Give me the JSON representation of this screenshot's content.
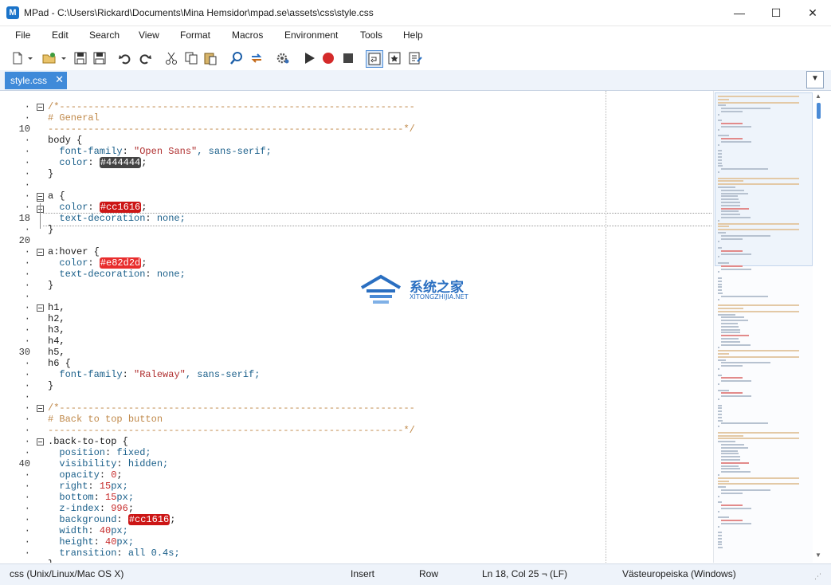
{
  "window": {
    "app_icon_letter": "M",
    "title": "MPad - C:\\Users\\Rickard\\Documents\\Mina Hemsidor\\mpad.se\\assets\\css\\style.css",
    "minimize": "—",
    "maximize": "☐",
    "close": "✕"
  },
  "menu": [
    "File",
    "Edit",
    "Search",
    "View",
    "Format",
    "Macros",
    "Environment",
    "Tools",
    "Help"
  ],
  "tab": {
    "label": "style.css",
    "close": "✕",
    "dropdown": "▼"
  },
  "gutter": {
    "numbers": [
      {
        "row": 0,
        "text": "·"
      },
      {
        "row": 1,
        "text": "·"
      },
      {
        "row": 2,
        "text": "10"
      },
      {
        "row": 3,
        "text": "·"
      },
      {
        "row": 4,
        "text": "·"
      },
      {
        "row": 5,
        "text": "·"
      },
      {
        "row": 6,
        "text": "·"
      },
      {
        "row": 7,
        "text": "·"
      },
      {
        "row": 8,
        "text": "·"
      },
      {
        "row": 9,
        "text": "·"
      },
      {
        "row": 10,
        "text": "18"
      },
      {
        "row": 11,
        "text": "·"
      },
      {
        "row": 12,
        "text": "20"
      },
      {
        "row": 13,
        "text": "·"
      },
      {
        "row": 14,
        "text": "·"
      },
      {
        "row": 15,
        "text": "·"
      },
      {
        "row": 16,
        "text": "·"
      },
      {
        "row": 17,
        "text": "·"
      },
      {
        "row": 18,
        "text": "·"
      },
      {
        "row": 19,
        "text": "·"
      },
      {
        "row": 20,
        "text": "·"
      },
      {
        "row": 21,
        "text": "·"
      },
      {
        "row": 22,
        "text": "30"
      },
      {
        "row": 23,
        "text": "·"
      },
      {
        "row": 24,
        "text": "·"
      },
      {
        "row": 25,
        "text": "·"
      },
      {
        "row": 26,
        "text": "·"
      },
      {
        "row": 27,
        "text": "·"
      },
      {
        "row": 28,
        "text": "·"
      },
      {
        "row": 29,
        "text": "·"
      },
      {
        "row": 30,
        "text": "·"
      },
      {
        "row": 31,
        "text": "·"
      },
      {
        "row": 32,
        "text": "40"
      },
      {
        "row": 33,
        "text": "·"
      },
      {
        "row": 34,
        "text": "·"
      },
      {
        "row": 35,
        "text": "·"
      },
      {
        "row": 36,
        "text": "·"
      },
      {
        "row": 37,
        "text": "·"
      },
      {
        "row": 38,
        "text": "·"
      },
      {
        "row": 39,
        "text": "·"
      },
      {
        "row": 40,
        "text": "·"
      },
      {
        "row": 41,
        "text": "·"
      }
    ]
  },
  "code": [
    {
      "row": 0,
      "segments": [
        {
          "t": "/*--------------------------------------------------------------",
          "c": "c"
        }
      ]
    },
    {
      "row": 1,
      "segments": [
        {
          "t": "# General",
          "c": "c"
        }
      ]
    },
    {
      "row": 2,
      "segments": [
        {
          "t": "--------------------------------------------------------------*/",
          "c": "c"
        }
      ]
    },
    {
      "row": 3,
      "segments": [
        {
          "t": "body {",
          "c": "sel"
        }
      ]
    },
    {
      "row": 4,
      "segments": [
        {
          "t": "  font-family",
          "c": "prop"
        },
        {
          "t": ": ",
          "c": "sel"
        },
        {
          "t": "\"Open Sans\"",
          "c": "str"
        },
        {
          "t": ", sans-serif;",
          "c": "kw"
        }
      ]
    },
    {
      "row": 5,
      "segments": [
        {
          "t": "  color",
          "c": "prop"
        },
        {
          "t": ": ",
          "c": "sel"
        },
        {
          "t": "#444444",
          "c": "swatch-dark"
        },
        {
          "t": ";",
          "c": "sel"
        }
      ]
    },
    {
      "row": 6,
      "segments": [
        {
          "t": "}",
          "c": "sel"
        }
      ]
    },
    {
      "row": 7,
      "segments": [
        {
          "t": "",
          "c": "sel"
        }
      ]
    },
    {
      "row": 8,
      "segments": [
        {
          "t": "a {",
          "c": "sel"
        }
      ]
    },
    {
      "row": 9,
      "segments": [
        {
          "t": "  color",
          "c": "prop"
        },
        {
          "t": ": ",
          "c": "sel"
        },
        {
          "t": "#cc1616",
          "c": "swatch-red"
        },
        {
          "t": ";",
          "c": "sel"
        }
      ]
    },
    {
      "row": 10,
      "segments": [
        {
          "t": "  text-decoration",
          "c": "prop"
        },
        {
          "t": ": ",
          "c": "sel"
        },
        {
          "t": "none;",
          "c": "kw"
        }
      ]
    },
    {
      "row": 11,
      "segments": [
        {
          "t": "}",
          "c": "sel"
        }
      ]
    },
    {
      "row": 12,
      "segments": [
        {
          "t": "",
          "c": "sel"
        }
      ]
    },
    {
      "row": 13,
      "segments": [
        {
          "t": "a:hover {",
          "c": "sel"
        }
      ]
    },
    {
      "row": 14,
      "segments": [
        {
          "t": "  color",
          "c": "prop"
        },
        {
          "t": ": ",
          "c": "sel"
        },
        {
          "t": "#e82d2d",
          "c": "swatch-red2"
        },
        {
          "t": ";",
          "c": "sel"
        }
      ]
    },
    {
      "row": 15,
      "segments": [
        {
          "t": "  text-decoration",
          "c": "prop"
        },
        {
          "t": ": ",
          "c": "sel"
        },
        {
          "t": "none;",
          "c": "kw"
        }
      ]
    },
    {
      "row": 16,
      "segments": [
        {
          "t": "}",
          "c": "sel"
        }
      ]
    },
    {
      "row": 17,
      "segments": [
        {
          "t": "",
          "c": "sel"
        }
      ]
    },
    {
      "row": 18,
      "segments": [
        {
          "t": "h1,",
          "c": "sel"
        }
      ]
    },
    {
      "row": 19,
      "segments": [
        {
          "t": "h2,",
          "c": "sel"
        }
      ]
    },
    {
      "row": 20,
      "segments": [
        {
          "t": "h3,",
          "c": "sel"
        }
      ]
    },
    {
      "row": 21,
      "segments": [
        {
          "t": "h4,",
          "c": "sel"
        }
      ]
    },
    {
      "row": 22,
      "segments": [
        {
          "t": "h5,",
          "c": "sel"
        }
      ]
    },
    {
      "row": 23,
      "segments": [
        {
          "t": "h6 {",
          "c": "sel"
        }
      ]
    },
    {
      "row": 24,
      "segments": [
        {
          "t": "  font-family",
          "c": "prop"
        },
        {
          "t": ": ",
          "c": "sel"
        },
        {
          "t": "\"Raleway\"",
          "c": "str"
        },
        {
          "t": ", sans-serif;",
          "c": "kw"
        }
      ]
    },
    {
      "row": 25,
      "segments": [
        {
          "t": "}",
          "c": "sel"
        }
      ]
    },
    {
      "row": 26,
      "segments": [
        {
          "t": "",
          "c": "sel"
        }
      ]
    },
    {
      "row": 27,
      "segments": [
        {
          "t": "/*--------------------------------------------------------------",
          "c": "c"
        }
      ]
    },
    {
      "row": 28,
      "segments": [
        {
          "t": "# Back to top button",
          "c": "c"
        }
      ]
    },
    {
      "row": 29,
      "segments": [
        {
          "t": "--------------------------------------------------------------*/",
          "c": "c"
        }
      ]
    },
    {
      "row": 30,
      "segments": [
        {
          "t": ".back-to-top {",
          "c": "sel"
        }
      ]
    },
    {
      "row": 31,
      "segments": [
        {
          "t": "  position",
          "c": "prop"
        },
        {
          "t": ": ",
          "c": "sel"
        },
        {
          "t": "fixed;",
          "c": "kw"
        }
      ]
    },
    {
      "row": 32,
      "segments": [
        {
          "t": "  visibility",
          "c": "prop"
        },
        {
          "t": ": ",
          "c": "sel"
        },
        {
          "t": "hidden;",
          "c": "kw"
        }
      ]
    },
    {
      "row": 33,
      "segments": [
        {
          "t": "  opacity",
          "c": "prop"
        },
        {
          "t": ": ",
          "c": "sel"
        },
        {
          "t": "0",
          "c": "num"
        },
        {
          "t": ";",
          "c": "sel"
        }
      ]
    },
    {
      "row": 34,
      "segments": [
        {
          "t": "  right",
          "c": "prop"
        },
        {
          "t": ": ",
          "c": "sel"
        },
        {
          "t": "15",
          "c": "num"
        },
        {
          "t": "px;",
          "c": "kw"
        }
      ]
    },
    {
      "row": 35,
      "segments": [
        {
          "t": "  bottom",
          "c": "prop"
        },
        {
          "t": ": ",
          "c": "sel"
        },
        {
          "t": "15",
          "c": "num"
        },
        {
          "t": "px;",
          "c": "kw"
        }
      ]
    },
    {
      "row": 36,
      "segments": [
        {
          "t": "  z-index",
          "c": "prop"
        },
        {
          "t": ": ",
          "c": "sel"
        },
        {
          "t": "996",
          "c": "num"
        },
        {
          "t": ";",
          "c": "sel"
        }
      ]
    },
    {
      "row": 37,
      "segments": [
        {
          "t": "  background",
          "c": "prop"
        },
        {
          "t": ": ",
          "c": "sel"
        },
        {
          "t": "#cc1616",
          "c": "swatch-red"
        },
        {
          "t": ";",
          "c": "sel"
        }
      ]
    },
    {
      "row": 38,
      "segments": [
        {
          "t": "  width",
          "c": "prop"
        },
        {
          "t": ": ",
          "c": "sel"
        },
        {
          "t": "40",
          "c": "num"
        },
        {
          "t": "px;",
          "c": "kw"
        }
      ]
    },
    {
      "row": 39,
      "segments": [
        {
          "t": "  height",
          "c": "prop"
        },
        {
          "t": ": ",
          "c": "sel"
        },
        {
          "t": "40",
          "c": "num"
        },
        {
          "t": "px;",
          "c": "kw"
        }
      ]
    },
    {
      "row": 40,
      "segments": [
        {
          "t": "  transition",
          "c": "prop"
        },
        {
          "t": ": ",
          "c": "sel"
        },
        {
          "t": "all 0.4s;",
          "c": "kw"
        }
      ]
    },
    {
      "row": 41,
      "segments": [
        {
          "t": "}",
          "c": "sel"
        }
      ]
    }
  ],
  "watermark": {
    "title": "系统之家",
    "subtitle": "XITONGZHIJIA.NET"
  },
  "status": {
    "syntax": "css (Unix/Linux/Mac OS X)",
    "mode": "Insert",
    "selection": "Row",
    "position": "Ln 18, Col 25 ¬ (LF)",
    "encoding": "Västeuropeiska (Windows)"
  },
  "colors": {
    "accent": "#3f8ad9",
    "comment": "#c0894a",
    "property": "#1a5f8a",
    "swatch_red": "#cc1616"
  }
}
